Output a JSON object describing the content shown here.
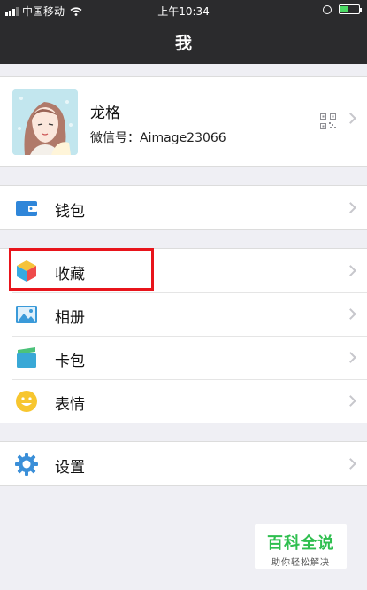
{
  "status_bar": {
    "carrier": "中国移动",
    "time": "上午10:34"
  },
  "nav": {
    "title": "我"
  },
  "profile": {
    "name": "龙格",
    "wechat_id": "微信号：Aimage23066",
    "avatar_icon": "avatar-illustration",
    "qr_icon": "qr-code-icon"
  },
  "menu": {
    "wallet": {
      "label": "钱包",
      "icon": "wallet-icon",
      "color": "#2f86d9"
    },
    "favorites": {
      "label": "收藏",
      "icon": "cube-icon",
      "highlighted": true
    },
    "album": {
      "label": "相册",
      "icon": "photo-icon",
      "color": "#3a9ad9"
    },
    "cards": {
      "label": "卡包",
      "icon": "card-icon",
      "color": "#39a8d6"
    },
    "stickers": {
      "label": "表情",
      "icon": "smiley-icon",
      "color": "#f7c62f"
    },
    "settings": {
      "label": "设置",
      "icon": "gear-icon",
      "color": "#3b8fd8"
    }
  },
  "highlight_color": "#e8141b",
  "watermark": {
    "title": "百科全说",
    "subtitle": "助你轻松解决",
    "color": "#2fbf4f"
  }
}
